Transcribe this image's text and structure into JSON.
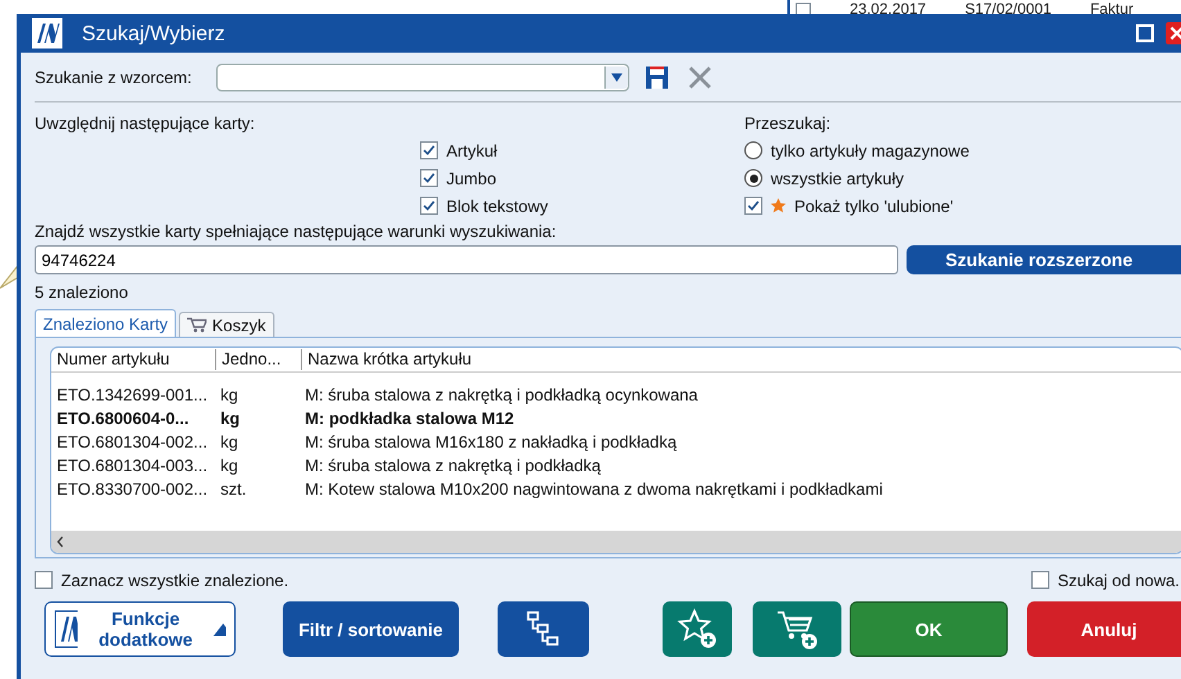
{
  "background_window": {
    "checked": false,
    "cells": [
      "23.02.2017",
      "S17/02/0001",
      "Faktur"
    ]
  },
  "window": {
    "title": "Szukaj/Wybierz"
  },
  "template": {
    "label": "Szukanie z wzorcem:"
  },
  "cards": {
    "label": "Uwzględnij następujące karty:",
    "options": [
      {
        "label": "Artykuł",
        "checked": true
      },
      {
        "label": "Jumbo",
        "checked": true
      },
      {
        "label": "Blok tekstowy",
        "checked": true
      }
    ]
  },
  "search_in": {
    "label": "Przeszukaj:",
    "options": [
      {
        "label": "tylko artykuły magazynowe",
        "selected": false
      },
      {
        "label": "wszystkie artykuły",
        "selected": true
      }
    ],
    "favorites": {
      "label": "Pokaż tylko 'ulubione'",
      "checked": true
    }
  },
  "query": {
    "label": "Znajdź wszystkie karty spełniające następujące warunki wyszukiwania:",
    "value": "94746224",
    "button": "Szukanie rozszerzone"
  },
  "result_count": "5 znaleziono",
  "tabs": [
    {
      "label": "Znaleziono Karty",
      "selected": true
    },
    {
      "label": "Koszyk",
      "selected": false
    }
  ],
  "table": {
    "columns": [
      "Numer artykułu",
      "Jedno...",
      "Nazwa krótka artykułu"
    ],
    "rows": [
      {
        "cells": [
          "ETO.1342699-001...",
          "kg",
          "M: śruba stalowa z nakrętką i podkładką ocynkowana"
        ],
        "selected": false
      },
      {
        "cells": [
          "ETO.6800604-0...",
          "kg",
          "M: podkładka stalowa M12"
        ],
        "selected": true
      },
      {
        "cells": [
          "ETO.6801304-002...",
          "kg",
          "M: śruba stalowa M16x180 z nakładką i podkładką"
        ],
        "selected": false
      },
      {
        "cells": [
          "ETO.6801304-003...",
          "kg",
          "M: śruba stalowa z nakrętką i podkładką"
        ],
        "selected": false
      },
      {
        "cells": [
          "ETO.8330700-002...",
          "szt.",
          "M: Kotew stalowa M10x200 nagwintowana z dwoma nakrętkami i podkładkami"
        ],
        "selected": false
      }
    ]
  },
  "select_all": {
    "label": "Zaznacz wszystkie znalezione.",
    "checked": false
  },
  "search_again": {
    "label": "Szukaj od nowa.",
    "checked": false
  },
  "buttons": {
    "functions": "Funkcje dodatkowe",
    "filter": "Filtr / sortowanie",
    "ok": "OK",
    "cancel": "Anuluj"
  }
}
